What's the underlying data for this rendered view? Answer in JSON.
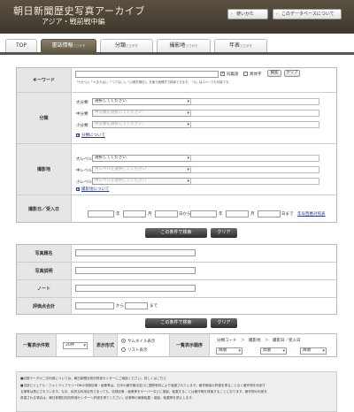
{
  "header": {
    "title": "朝日新聞歴史写真アーカイブ",
    "subtitle": "アジア・戦前戦中編",
    "help_label": "使いかた",
    "about_label": "このデータベースについて"
  },
  "tabs": [
    {
      "label": "TOP",
      "en": ""
    },
    {
      "label": "書誌情報",
      "en": "でさがす"
    },
    {
      "label": "分類",
      "en": "でさがす"
    },
    {
      "label": "撮影地",
      "en": "でさがす"
    },
    {
      "label": "年表",
      "en": "でさがす"
    }
  ],
  "keyword": {
    "label": "キーワード",
    "synonym_label": "同義語",
    "notation_label": "異体字",
    "search_button": "検索",
    "clear_button": "クリア",
    "hint": "「*(かつ)」「+(または)」「^(でない)」「()(優先順位)」を使う論理式で検索できます。「&」はスペースも可能です。"
  },
  "classification": {
    "label": "分類",
    "major_label": "大分類",
    "major_value": "選択してください",
    "middle_label": "中分類",
    "middle_value": "中分類を選択してください",
    "minor_label": "小分類",
    "minor_value": "中分類を選択してください",
    "about_link": "分類について"
  },
  "location": {
    "label": "撮影地",
    "large_label": "大レベル",
    "large_value": "選択してください",
    "mid_label": "中レベル",
    "mid_value": "大レベルを選択してください",
    "small_label": "小レベル",
    "small_value": "中レベルを選択してください",
    "about_link": "撮影地について"
  },
  "date": {
    "label": "撮影日／受入日",
    "year": "年",
    "month": "月",
    "day_from": "日から",
    "day_to": "日まで",
    "calendar_link": "年号西暦対照表"
  },
  "search_button": "この条件で検索",
  "clear_button": "クリア",
  "fields": [
    {
      "label": "写真題名"
    },
    {
      "label": "写真説明"
    },
    {
      "label": "ノート"
    }
  ],
  "rating": {
    "label": "評価点合計",
    "from": "から",
    "to": "まで"
  },
  "display": {
    "count_label": "一覧表示件数",
    "count_value": "20件",
    "format_label": "表示形式",
    "thumbnail_label": "サムネイル表示",
    "list_label": "リスト表示",
    "order_label": "一覧表示順序",
    "order_text": "分類コード　＞　撮影地　＞　撮影日／受入日",
    "order_values": [
      "降順",
      "昇順",
      "降順"
    ]
  },
  "footer": {
    "notes": [
      "■収録データの二次利用については、朝日新聞社知的財産センターにご相談ください。詳しくはこちら",
      "■当該ビジュアル・フォトライブラリーDBの収録記事・画像等は、日本の著作権法並びに国際条約により保護されています。著作権者の許諾を得ることなく著作物を利用す",
      "る事等は禁止されています。なお、私的な利用目的であっても、収録記事・画像等をサーバーなどに複製、転載することは著作権を侵害することになります。著作物の利用を",
      "希望される場合は、朝日新聞社知的財産センターへ許諾を得てください。記事等の無断転載・複製、転載等を禁止します。"
    ]
  }
}
